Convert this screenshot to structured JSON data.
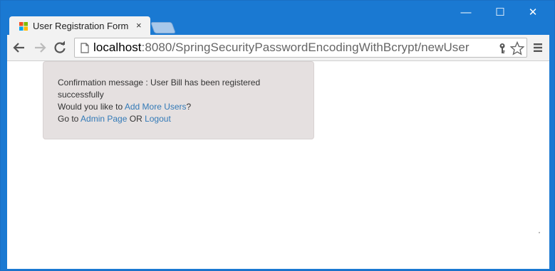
{
  "browser": {
    "tab_title": "User Registration Form",
    "tab_close": "×",
    "url_host": "localhost",
    "url_rest": ":8080/SpringSecurityPasswordEncodingWithBcrypt/newUser",
    "window_controls": {
      "minimize": "—",
      "maximize": "☐",
      "close": "✕"
    },
    "colors": {
      "titlebar": "#1a79d2",
      "toolbar": "#f2f2f2",
      "link": "#337ab7"
    }
  },
  "page": {
    "confirmation_prefix": "Confirmation message : User Bill has been registered successfully",
    "would_you_prefix": "Would you like to ",
    "add_more_users_link": "Add More Users",
    "would_you_suffix": "?",
    "goto_prefix": "Go to ",
    "admin_page_link": "Admin Page",
    "or_text": " OR ",
    "logout_link": "Logout"
  },
  "icons": {
    "favicon": "windows-logo-icon",
    "back": "back-arrow-icon",
    "forward": "forward-arrow-icon",
    "reload": "reload-icon",
    "page": "page-icon",
    "key": "key-icon",
    "star": "star-icon",
    "menu": "hamburger-menu-icon"
  }
}
